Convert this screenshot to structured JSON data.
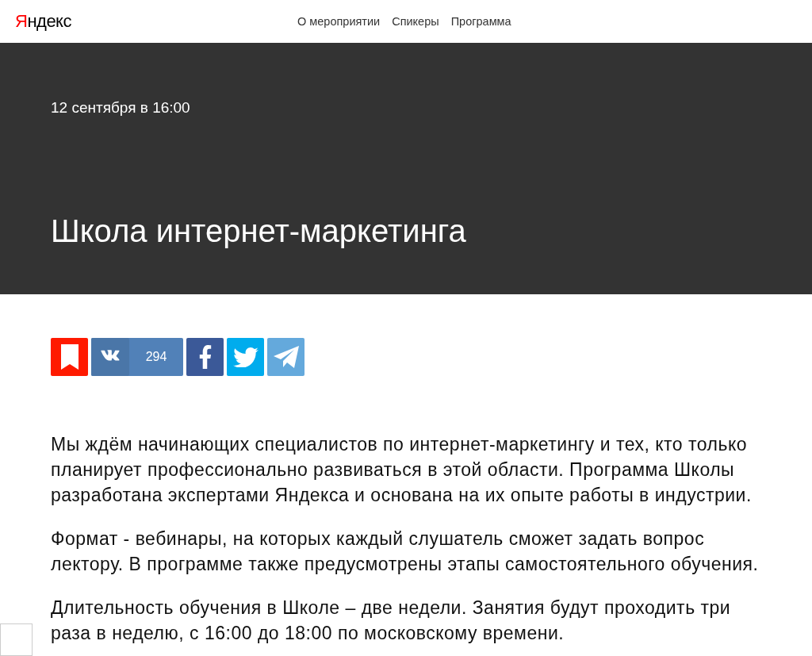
{
  "header": {
    "logo": "Яндекс",
    "nav": [
      "О мероприятии",
      "Спикеры",
      "Программа"
    ]
  },
  "hero": {
    "date": "12 сентября в 16:00",
    "title": "Школа интернет-маркетинга"
  },
  "share": [
    {
      "kind": "bookmark"
    },
    {
      "kind": "vk",
      "count": "294"
    },
    {
      "kind": "facebook"
    },
    {
      "kind": "twitter"
    },
    {
      "kind": "telegram"
    }
  ],
  "paragraphs": [
    "Мы ждём начинающих специалистов по интернет-маркетингу и тех, кто только планирует профессионально развиваться в этой области. Программа Школы разработана экспертами Яндекса и основана на их опыте работы в индустрии.",
    "Формат - вебинары, на которых каждый слушатель сможет задать вопрос лектору. В программе также предусмотрены этапы самостоятельного обучения.",
    "Длительность обучения в Школе – две недели. Занятия будут проходить три раза в неделю, с 16:00 до 18:00 по московскому времени."
  ]
}
